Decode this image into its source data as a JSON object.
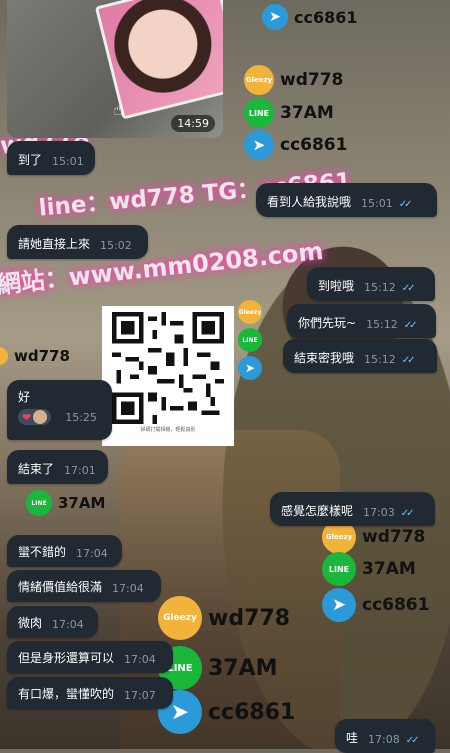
{
  "watermark": {
    "line1": "wd778",
    "line2": "line：wd778 TG：cc6861",
    "line3": "網站：www.mm0208.com",
    "brands": [
      {
        "icon": "gleezy-icon",
        "label": "wd778"
      },
      {
        "icon": "line-icon",
        "label": "37AM"
      },
      {
        "icon": "telegram-icon",
        "label": "cc6861"
      }
    ],
    "gleezy_text": "Gleezy",
    "line_text": "LINE"
  },
  "photo": {
    "time": "14:59"
  },
  "messages": [
    {
      "id": "m1",
      "dir": "in",
      "text": "到了",
      "time": "15:01"
    },
    {
      "id": "m2",
      "dir": "out",
      "text": "看到人給我說哦",
      "time": "15:01"
    },
    {
      "id": "m3",
      "dir": "in",
      "text": "請她直接上來",
      "time": "15:02"
    },
    {
      "id": "m4",
      "dir": "out",
      "text": "到啦哦",
      "time": "15:12"
    },
    {
      "id": "m5",
      "dir": "out",
      "text": "你們先玩~",
      "time": "15:12"
    },
    {
      "id": "m6",
      "dir": "out",
      "text": "結束密我哦",
      "time": "15:12"
    },
    {
      "id": "m7",
      "dir": "in",
      "text": "好",
      "time": "15:25",
      "reaction": "❤",
      "reaction_count": ""
    },
    {
      "id": "m8",
      "dir": "in",
      "text": "結束了",
      "time": "17:01"
    },
    {
      "id": "m9",
      "dir": "out",
      "text": "感覺怎麼樣呢",
      "time": "17:03"
    },
    {
      "id": "m10",
      "dir": "in",
      "text": "蠻不錯的",
      "time": "17:04"
    },
    {
      "id": "m11",
      "dir": "in",
      "text": "情緒價值給很滿",
      "time": "17:04"
    },
    {
      "id": "m12",
      "dir": "in",
      "text": "微肉",
      "time": "17:04"
    },
    {
      "id": "m13",
      "dir": "in",
      "text": "但是身形還算可以",
      "time": "17:04"
    },
    {
      "id": "m14",
      "dir": "in",
      "text": "有口爆，蠻懂吹的",
      "time": "17:07"
    },
    {
      "id": "m15",
      "dir": "out",
      "text": "哇",
      "time": "17:08"
    }
  ],
  "checkmark": "✓✓",
  "qr_caption": "掃碼打開相機，輕鬆識別"
}
